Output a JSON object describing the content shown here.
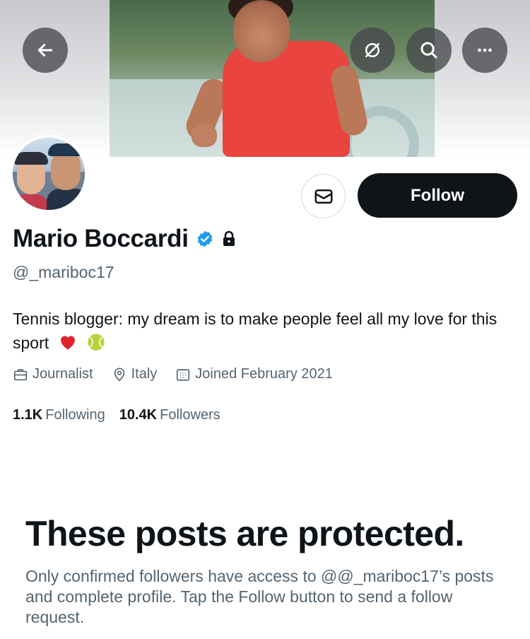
{
  "header": {
    "back_icon": "arrow-left-icon",
    "grok_icon": "grok-icon",
    "search_icon": "search-icon",
    "more_icon": "more-horizontal-icon"
  },
  "profile": {
    "name": "Mario Boccardi",
    "handle": "@_mariboc17",
    "bio": "Tennis blogger: my dream is to make people feel all my love for this sport",
    "bio_emojis": [
      "red-heart",
      "tennis-ball"
    ],
    "verified": true,
    "protected": true,
    "profession": "Journalist",
    "location": "Italy",
    "joined": "Joined February 2021"
  },
  "actions": {
    "follow_label": "Follow",
    "message_icon": "envelope-icon"
  },
  "stats": {
    "following_count": "1.1K",
    "following_label": "Following",
    "followers_count": "10.4K",
    "followers_label": "Followers"
  },
  "protected_notice": {
    "title": "These posts are protected.",
    "body": "Only confirmed followers have access to @@_mariboc17’s posts and complete profile. Tap the Follow button to send a follow request."
  },
  "colors": {
    "follow_bg": "#0f1419",
    "secondary_text": "#536471",
    "verified_blue": "#1d9bf0"
  }
}
